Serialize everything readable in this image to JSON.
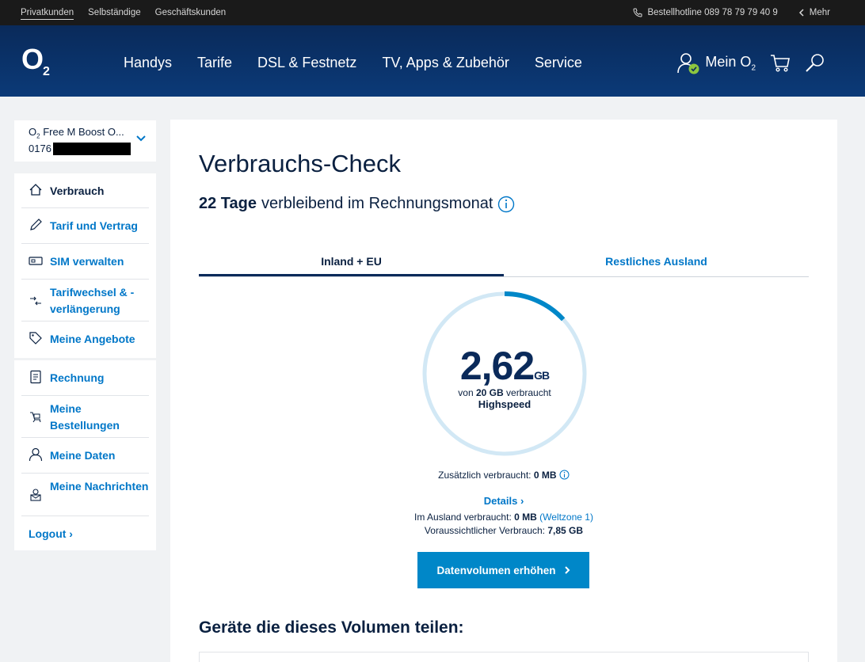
{
  "topbar": {
    "segments": [
      "Privatkunden",
      "Selbständige",
      "Geschäftskunden"
    ],
    "hotline": "Bestellhotline 089 78 79 79 40 9",
    "more": "Mehr"
  },
  "header": {
    "logo": "O",
    "logo_sub": "2",
    "nav": [
      "Handys",
      "Tarife",
      "DSL & Festnetz",
      "TV, Apps & Zubehör",
      "Service"
    ],
    "account_label": "Mein O",
    "account_sub": "2"
  },
  "sidebar": {
    "contract_name": "O",
    "contract_sub": "2",
    "contract_rest": " Free M Boost O...",
    "number_prefix": "0176",
    "menu1": [
      {
        "label": "Verbrauch",
        "icon": "home-icon"
      },
      {
        "label": "Tarif und Vertrag",
        "icon": "pencil-icon"
      },
      {
        "label": "SIM verwalten",
        "icon": "sim-icon"
      },
      {
        "label": "Tarifwechsel & -verlängerung",
        "icon": "switch-arrows-icon"
      },
      {
        "label": "Meine Angebote",
        "icon": "tag-icon"
      }
    ],
    "menu2": [
      {
        "label": "Rechnung",
        "icon": "invoice-icon"
      },
      {
        "label": "Meine Bestellungen",
        "icon": "cart-trolley-icon"
      },
      {
        "label": "Meine Daten",
        "icon": "user-icon"
      },
      {
        "label": "Meine Nachrichten",
        "icon": "messages-icon"
      }
    ],
    "logout": "Logout"
  },
  "main": {
    "title": "Verbrauchs-Check",
    "days_bold": "22 Tage",
    "days_rest": "verbleibend im Rechnungsmonat",
    "tabs": [
      "Inland + EU",
      "Restliches Ausland"
    ],
    "usage_value": "2,62",
    "usage_unit": "GB",
    "usage_of_prefix": "von",
    "usage_total": "20 GB",
    "usage_of_suffix": "verbraucht",
    "usage_speed": "Highspeed",
    "usage_fraction": 0.131,
    "extra_label": "Zusätzlich verbraucht:",
    "extra_value": "0 MB",
    "details": "Details",
    "abroad_label": "Im Ausland verbraucht:",
    "abroad_value": "0 MB",
    "abroad_zone": "(Weltzone 1)",
    "forecast_label": "Voraussichtlicher Verbrauch:",
    "forecast_value": "7,85 GB",
    "button": "Datenvolumen erhöhen",
    "share_title": "Geräte die dieses Volumen teilen:"
  },
  "colors": {
    "accent": "#0077c8",
    "header": "#0b3a78",
    "gauge_track": "#d2e8f5",
    "gauge_fill": "#0087c8"
  }
}
